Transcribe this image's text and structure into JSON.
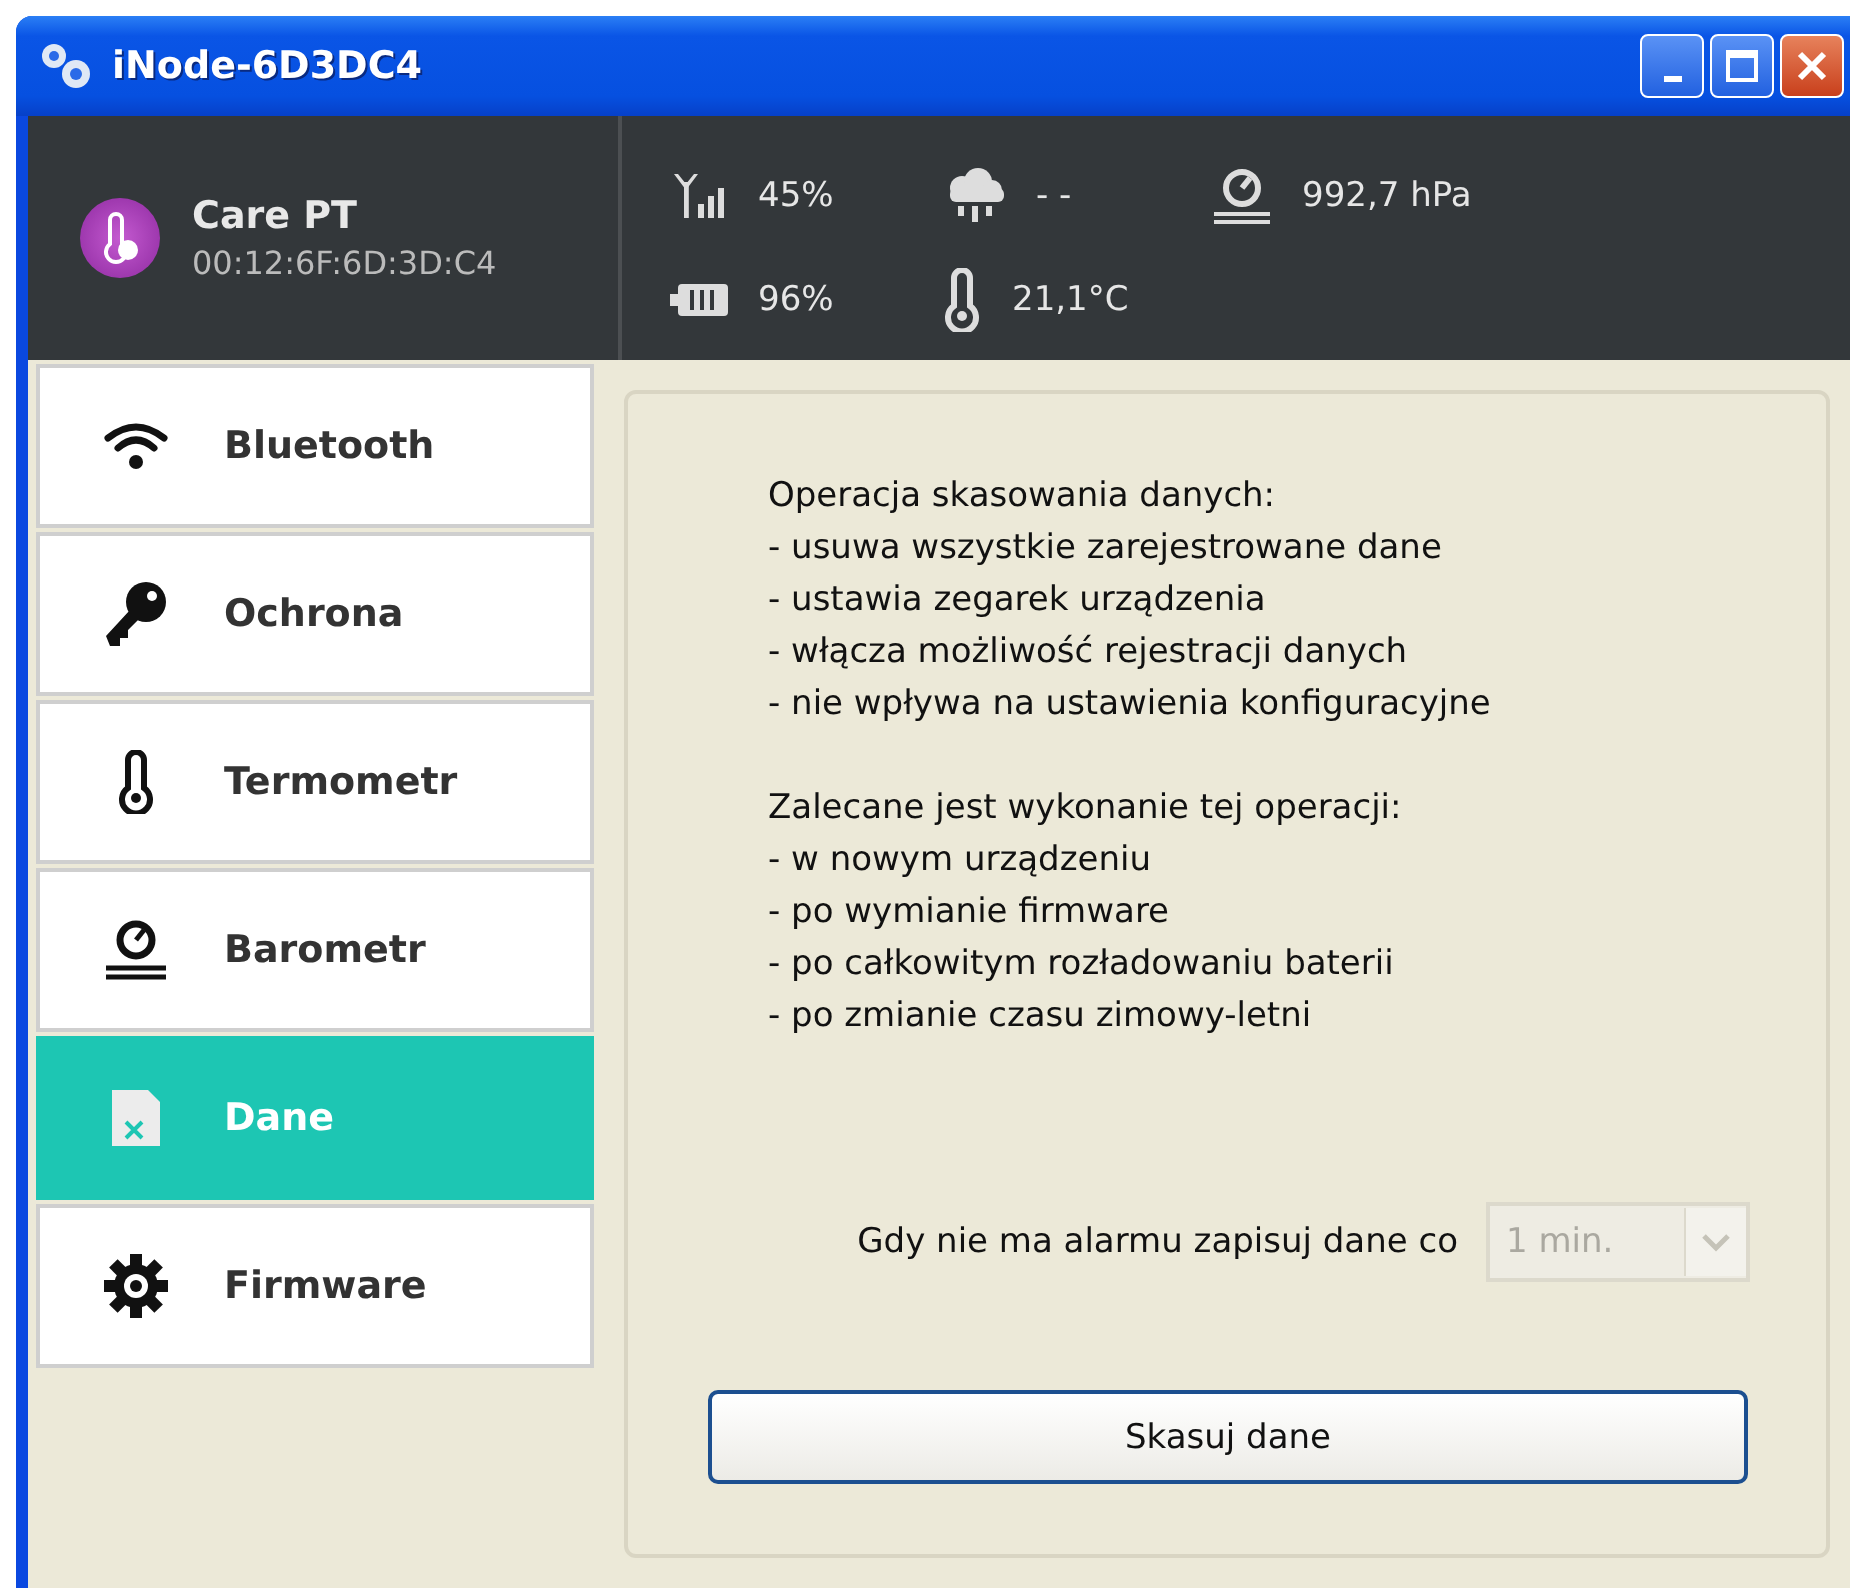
{
  "window": {
    "title": "iNode-6D3DC4"
  },
  "device": {
    "name": "Care PT",
    "mac": "00:12:6F:6D:3D:C4"
  },
  "readings": [
    {
      "kind": "signal",
      "value": "45%"
    },
    {
      "kind": "rain",
      "value": "- -"
    },
    {
      "kind": "pressure",
      "value": "992,7 hPa"
    },
    {
      "kind": "battery",
      "value": "96%"
    },
    {
      "kind": "temperature",
      "value": "21,1°C"
    }
  ],
  "sidebar": {
    "items": [
      {
        "kind": "wifi",
        "label": "Bluetooth",
        "selected": false
      },
      {
        "kind": "key",
        "label": "Ochrona",
        "selected": false
      },
      {
        "kind": "thermometer",
        "label": "Termometr",
        "selected": false
      },
      {
        "kind": "gauge",
        "label": "Barometr",
        "selected": false
      },
      {
        "kind": "data",
        "label": "Dane",
        "selected": true
      },
      {
        "kind": "gear",
        "label": "Firmware",
        "selected": false
      }
    ]
  },
  "info": [
    {
      "heading": "Operacja skasowania danych:",
      "items": [
        "- usuwa wszystkie zarejestrowane dane",
        "- ustawia zegarek urządzenia",
        "- włącza możliwość rejestracji danych",
        "- nie wpływa na ustawienia konfiguracyjne"
      ]
    },
    {
      "heading": "Zalecane jest wykonanie tej operacji:",
      "items": [
        "- w nowym urządzeniu",
        "- po wymianie firmware",
        "- po całkowitym rozładowaniu baterii",
        "- po zmianie czasu zimowy-letni"
      ]
    }
  ],
  "interval": {
    "label": "Gdy nie ma alarmu zapisuj dane co",
    "value": "1 min.",
    "disabled": true
  },
  "buttons": [
    {
      "label": "Skasuj dane"
    }
  ]
}
